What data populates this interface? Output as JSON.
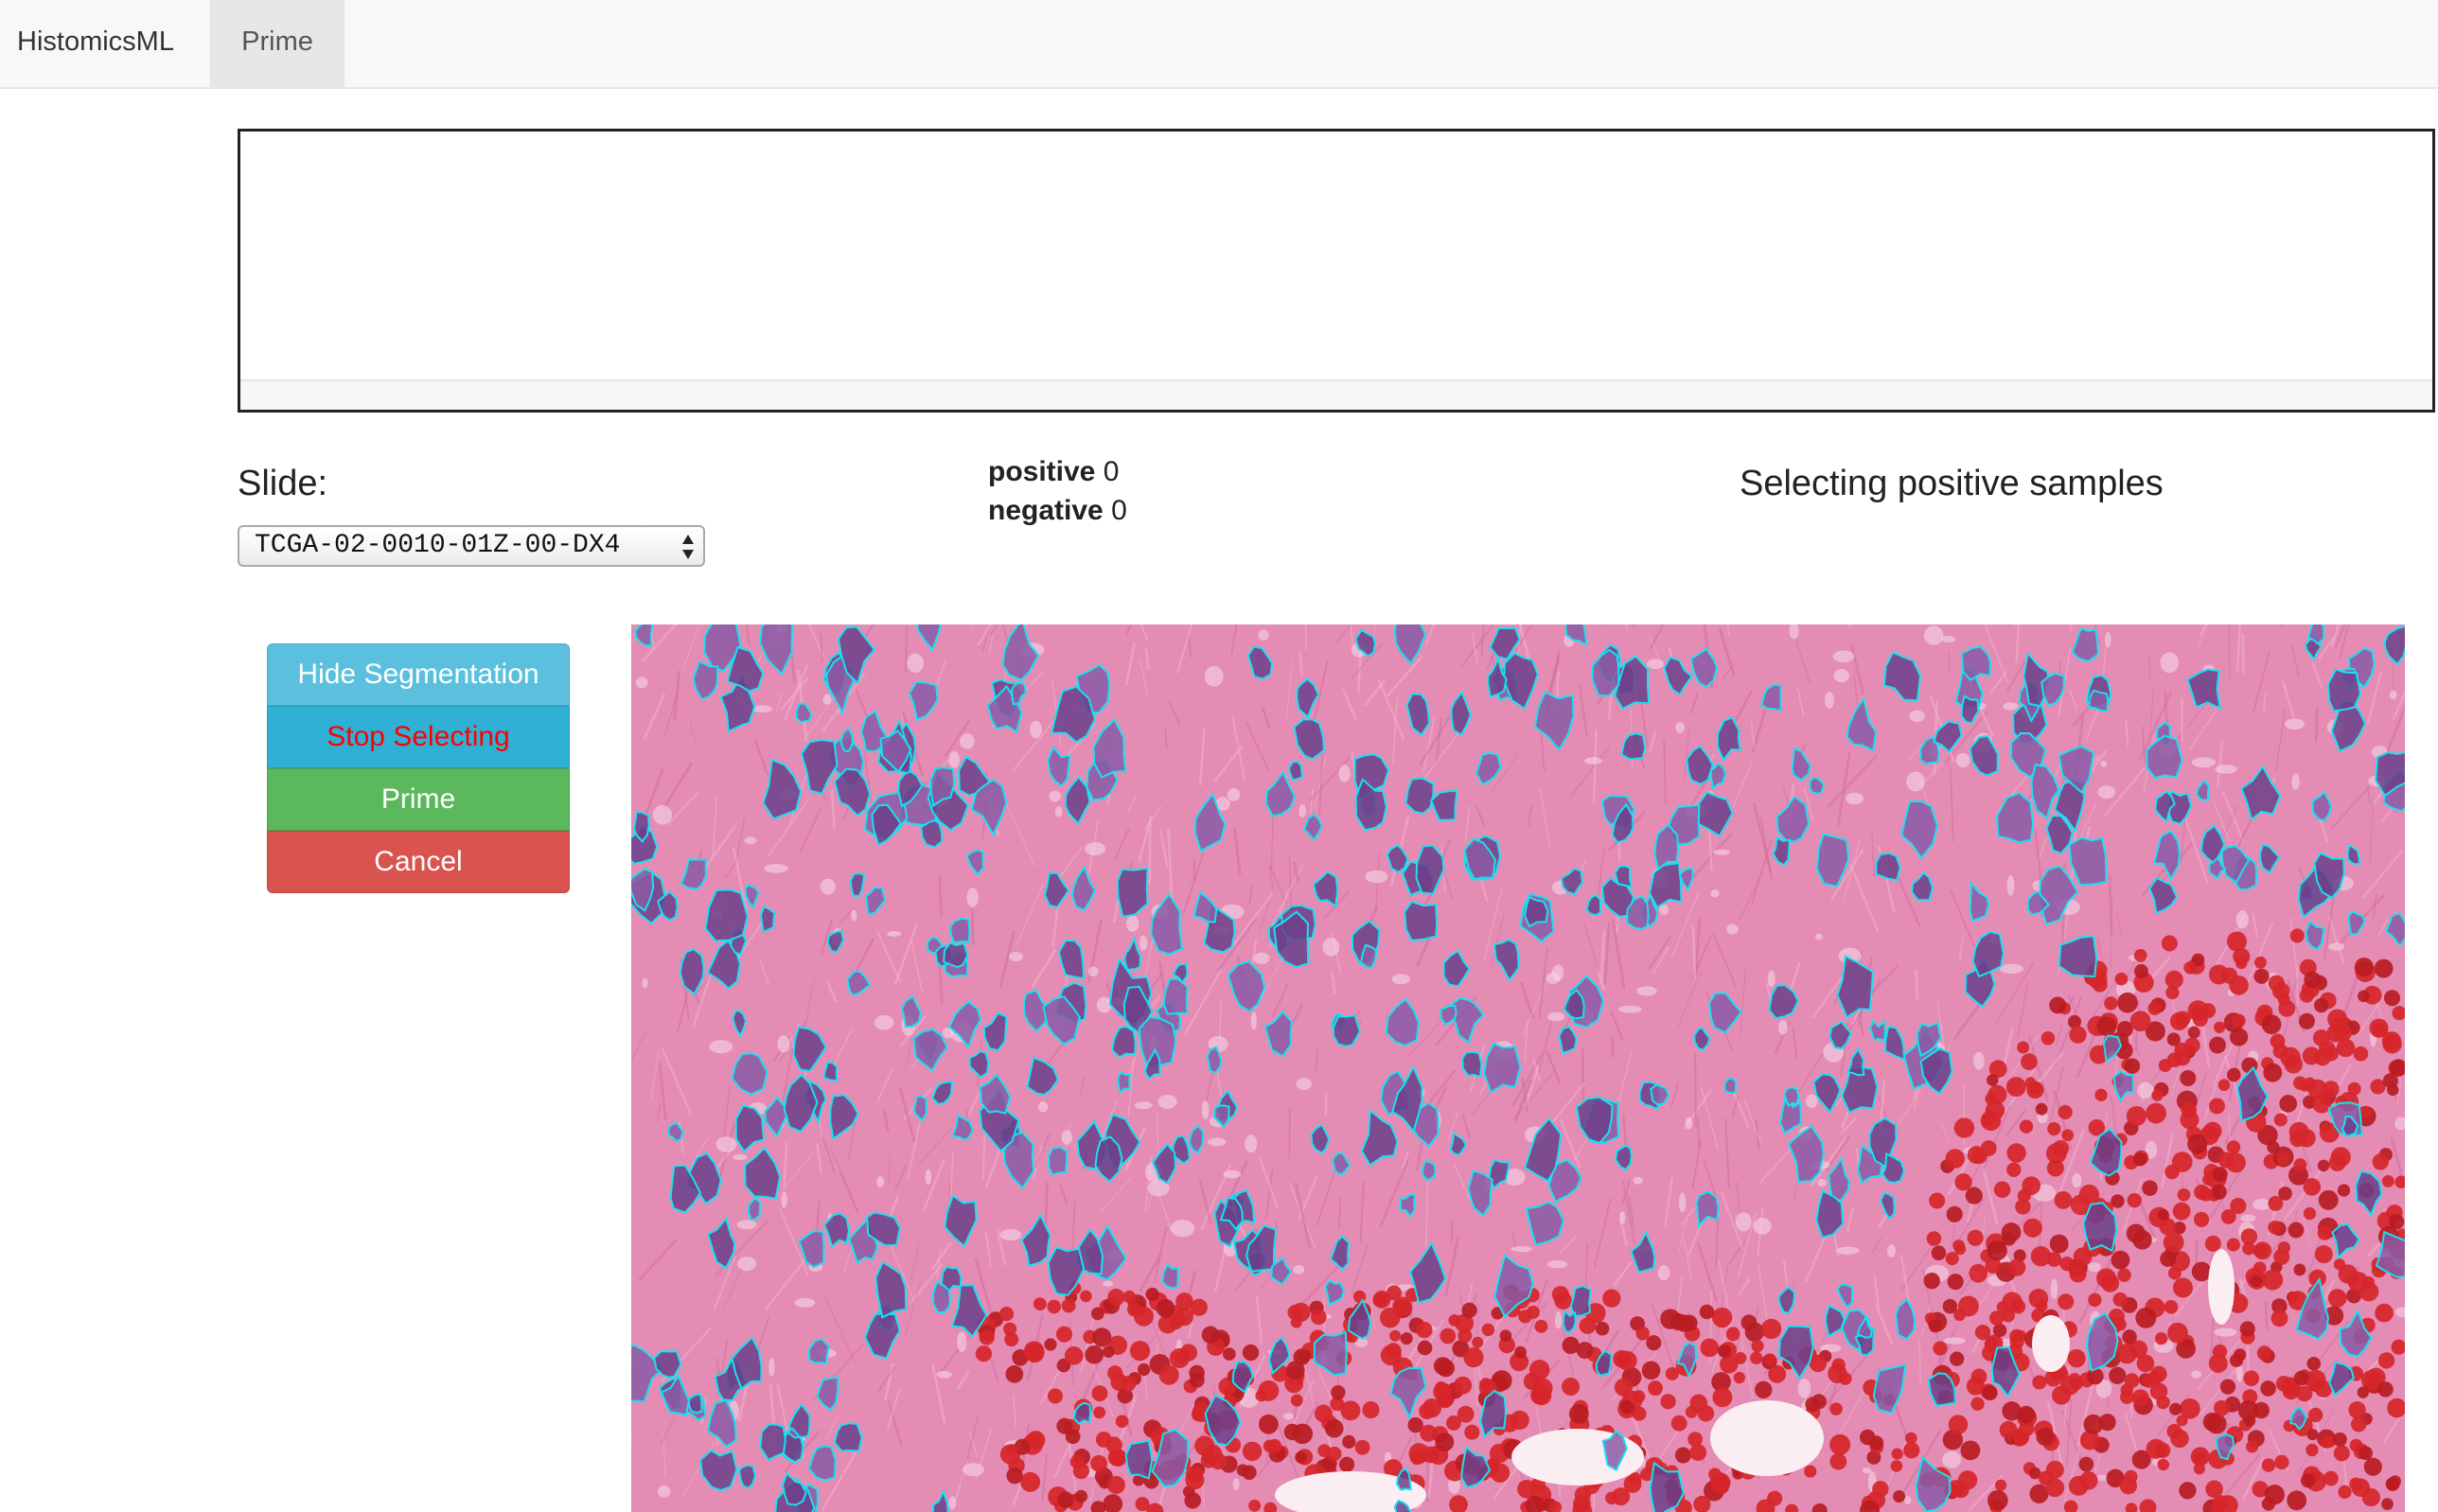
{
  "navbar": {
    "brand": "HistomicsML",
    "tabs": [
      {
        "label": "Prime",
        "active": true
      }
    ]
  },
  "slide": {
    "label": "Slide:",
    "selected": "TCGA-02-0010-01Z-00-DX4"
  },
  "counts": {
    "positive_label": "positive",
    "positive_value": "0",
    "negative_label": "negative",
    "negative_value": "0"
  },
  "status": "Selecting positive samples",
  "buttons": {
    "hide_segmentation": "Hide Segmentation",
    "stop_selecting": "Stop Selecting",
    "prime": "Prime",
    "cancel": "Cancel"
  },
  "colors": {
    "tissue_pink": "#e48cb4",
    "nucleus_purple": "#6b3f8a",
    "rbc_red": "#d6262a",
    "segmentation_outline": "#18e0f0",
    "stop_text": "#ff0000"
  }
}
